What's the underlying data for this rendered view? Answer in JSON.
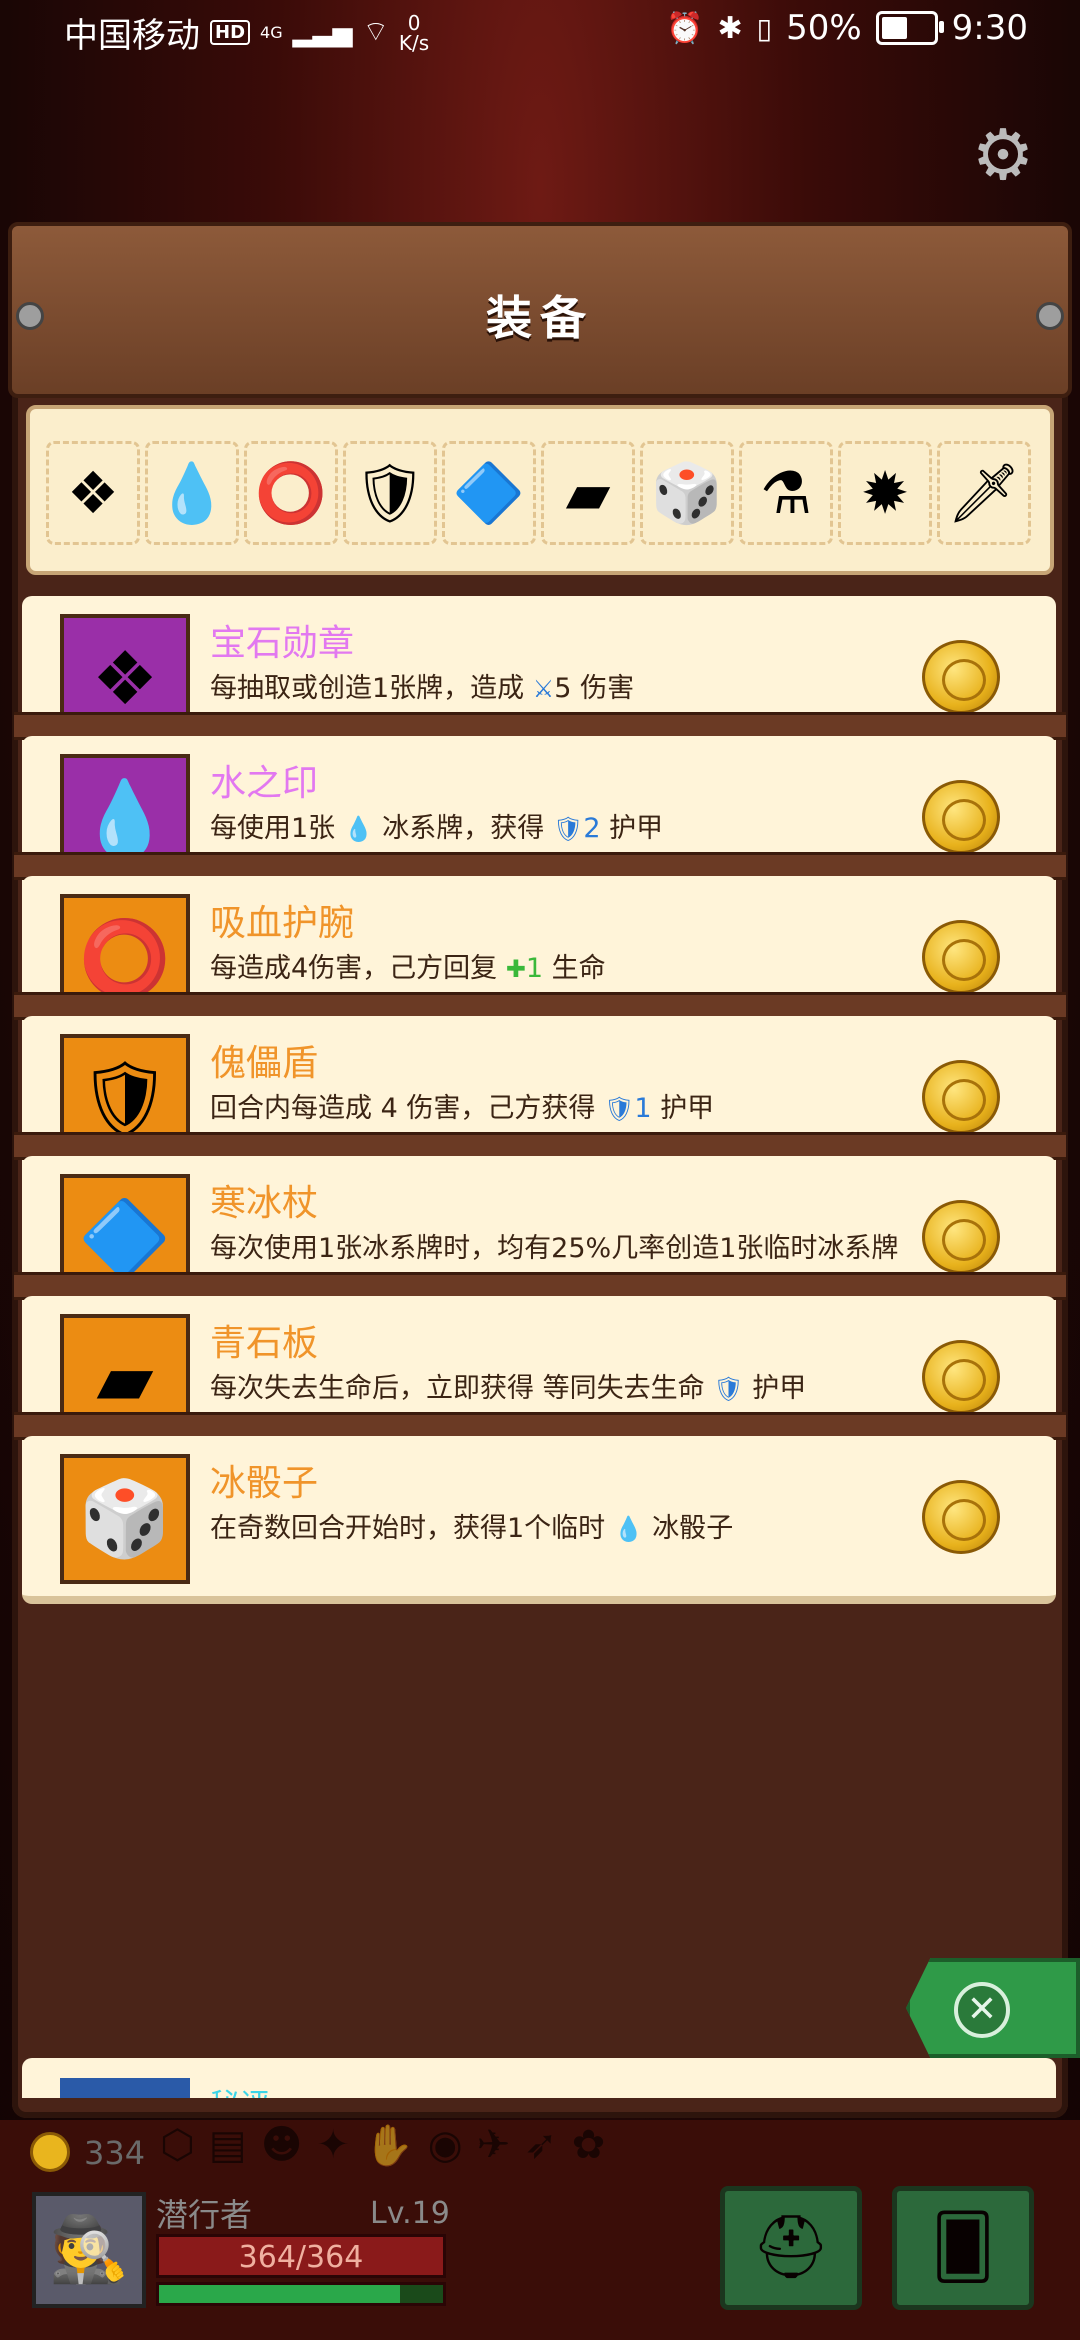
{
  "status_bar": {
    "carrier": "中国移动",
    "hd": "HD",
    "network": "4G",
    "speed_value": "0",
    "speed_unit": "K/s",
    "battery": "50%",
    "time": "9:30"
  },
  "header": {
    "title": "装备"
  },
  "icon_strip": {
    "icons": [
      {
        "name": "gem-medal-icon",
        "glyph": "❖"
      },
      {
        "name": "water-drop-icon",
        "glyph": "💧"
      },
      {
        "name": "spiked-bracelet-icon",
        "glyph": "⭕"
      },
      {
        "name": "puppet-shield-icon",
        "glyph": "🛡"
      },
      {
        "name": "ice-staff-icon",
        "glyph": "🔷"
      },
      {
        "name": "green-slate-icon",
        "glyph": "▰"
      },
      {
        "name": "ice-dice-icon",
        "glyph": "🎲"
      },
      {
        "name": "potion-flask-icon",
        "glyph": "⚗"
      },
      {
        "name": "spiked-ball-icon",
        "glyph": "✹"
      },
      {
        "name": "red-dagger-icon",
        "glyph": "🗡"
      }
    ]
  },
  "equipment": [
    {
      "title": "宝石勋章",
      "rarity_color": "purple",
      "thumb_glyph": "❖",
      "desc_before": "每抽取或创造1张牌，造成",
      "desc_icon": "⚔",
      "desc_value": "5",
      "desc_after": "伤害"
    },
    {
      "title": "水之印",
      "rarity_color": "purple",
      "thumb_glyph": "💧",
      "desc_before": "每使用1张",
      "desc_icon": "💧",
      "desc_value": "",
      "desc_after": "冰系牌，获得",
      "desc_icon2": "🛡",
      "desc_value2": "2",
      "desc_after2": "护甲"
    },
    {
      "title": "吸血护腕",
      "rarity_color": "orange",
      "thumb_glyph": "⭕",
      "desc_before": "每造成4伤害，己方回复",
      "desc_icon": "✚",
      "desc_value": "1",
      "desc_after": "生命"
    },
    {
      "title": "傀儡盾",
      "rarity_color": "orange",
      "thumb_glyph": "🛡",
      "desc_before": "回合内每造成 4 伤害，己方获得",
      "desc_icon": "🛡",
      "desc_value": "1",
      "desc_after": "护甲"
    },
    {
      "title": "寒冰杖",
      "rarity_color": "orange",
      "thumb_glyph": "🔷",
      "desc_before": "每次使用1张冰系牌时，均有25%几率创造1张临时冰系牌",
      "desc_icon": "",
      "desc_value": "",
      "desc_after": ""
    },
    {
      "title": "青石板",
      "rarity_color": "orange",
      "thumb_glyph": "▰",
      "desc_before": "每次失去生命后，立即获得 等同失去生命",
      "desc_icon": "🛡",
      "desc_value": "",
      "desc_after": "护甲"
    },
    {
      "title": "冰骰子",
      "rarity_color": "orange",
      "thumb_glyph": "🎲",
      "desc_before": "在奇数回合开始时，获得1个临时",
      "desc_icon": "💧",
      "desc_value": "",
      "desc_after": "冰骰子"
    }
  ],
  "partial_item": {
    "title": "秘评"
  },
  "player": {
    "gold": "334",
    "name": "潜行者",
    "level": "Lv.19",
    "hp": "364/364",
    "mana_fraction": 0.85
  },
  "colors": {
    "purple_thumb": "#9a2fa8",
    "orange_thumb": "#ec8c12",
    "purple_title": "#e278f0",
    "orange_title": "#f0942a",
    "card_bg": "#fff4d9",
    "close_green": "#2f9a48"
  }
}
